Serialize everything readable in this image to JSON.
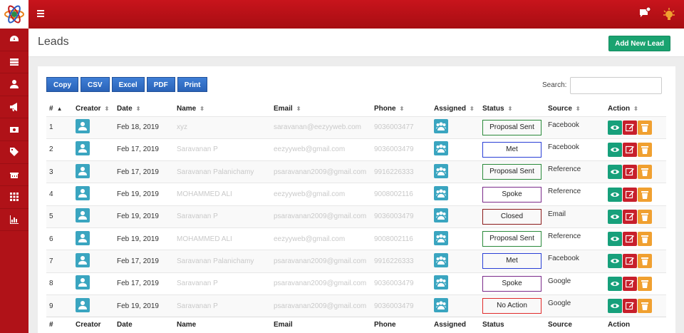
{
  "page": {
    "title": "Leads",
    "add_button": "Add New Lead"
  },
  "export": [
    "Copy",
    "CSV",
    "Excel",
    "PDF",
    "Print"
  ],
  "search": {
    "label": "Search:",
    "value": ""
  },
  "sidebar": [
    "dashboard-icon",
    "list-icon",
    "user-icon",
    "megaphone-icon",
    "money-icon",
    "tag-icon",
    "building-icon",
    "grid-icon",
    "bar-chart-icon"
  ],
  "table": {
    "headers": [
      "#",
      "Creator",
      "Date",
      "Name",
      "Email",
      "Phone",
      "Assigned",
      "Status",
      "Source",
      "Action"
    ],
    "rows": [
      {
        "num": "1",
        "date": "Feb 18, 2019",
        "name": "xyz",
        "email": "saravanan@eezyyweb.com",
        "phone": "9036003477",
        "status": "Proposal Sent",
        "status_color": "green",
        "source": "Facebook"
      },
      {
        "num": "2",
        "date": "Feb 17, 2019",
        "name": "Saravanan P",
        "email": "eezyyweb@gmail.com",
        "phone": "9036003479",
        "status": "Met",
        "status_color": "blue",
        "source": "Facebook"
      },
      {
        "num": "3",
        "date": "Feb 17, 2019",
        "name": "Saravanan Palanichamy",
        "email": "psaravanan2009@gmail.com",
        "phone": "9916226333",
        "status": "Proposal Sent",
        "status_color": "green",
        "source": "Reference"
      },
      {
        "num": "4",
        "date": "Feb 19, 2019",
        "name": "MOHAMMED ALI",
        "email": "eezyyweb@gmail.com",
        "phone": "9008002116",
        "status": "Spoke",
        "status_color": "purple",
        "source": "Reference"
      },
      {
        "num": "5",
        "date": "Feb 19, 2019",
        "name": "Saravanan P",
        "email": "psaravanan2009@gmail.com",
        "phone": "9036003479",
        "status": "Closed",
        "status_color": "darkred",
        "source": "Email"
      },
      {
        "num": "6",
        "date": "Feb 19, 2019",
        "name": "MOHAMMED ALI",
        "email": "eezyyweb@gmail.com",
        "phone": "9008002116",
        "status": "Proposal Sent",
        "status_color": "green",
        "source": "Reference"
      },
      {
        "num": "7",
        "date": "Feb 17, 2019",
        "name": "Saravanan Palanichamy",
        "email": "psaravanan2009@gmail.com",
        "phone": "9916226333",
        "status": "Met",
        "status_color": "blue",
        "source": "Facebook"
      },
      {
        "num": "8",
        "date": "Feb 17, 2019",
        "name": "Saravanan P",
        "email": "psaravanan2009@gmail.com",
        "phone": "9036003479",
        "status": "Spoke",
        "status_color": "purple",
        "source": "Google"
      },
      {
        "num": "9",
        "date": "Feb 19, 2019",
        "name": "Saravanan P",
        "email": "psaravanan2009@gmail.com",
        "phone": "9036003479",
        "status": "No Action",
        "status_color": "red",
        "source": "Google"
      }
    ]
  }
}
